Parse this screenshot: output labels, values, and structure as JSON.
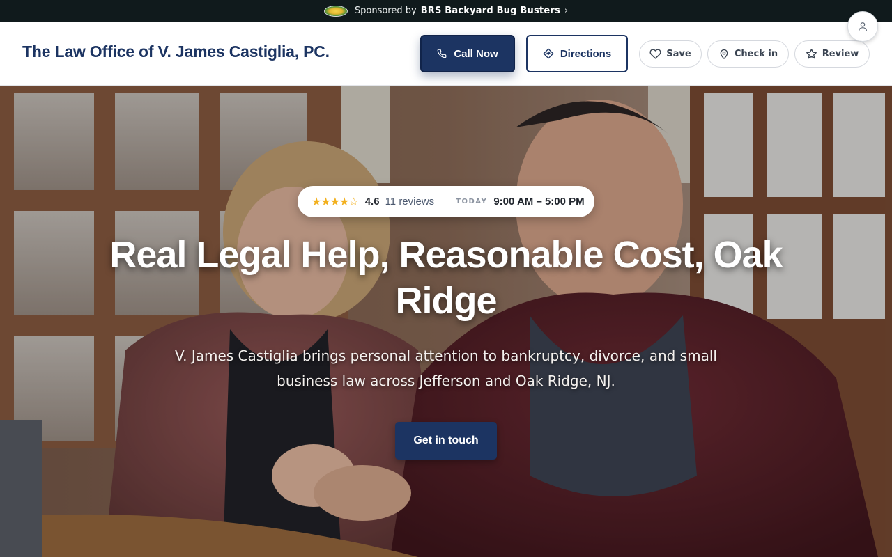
{
  "sponsor": {
    "prefix": "Sponsored by",
    "name": "BRS Backyard Bug Busters",
    "chevron": "›",
    "logo_icon": "sponsor-logo"
  },
  "header": {
    "brand": "The Law Office of V. James Castiglia, PC.",
    "call_label": "Call Now",
    "directions_label": "Directions",
    "save_label": "Save",
    "checkin_label": "Check in",
    "review_label": "Review"
  },
  "hero": {
    "rating": {
      "stars": "★★★★",
      "half_star": "☆",
      "value": "4.6",
      "reviews": "11 reviews",
      "today_label": "TODAY",
      "hours": "9:00 AM – 5:00 PM"
    },
    "headline": "Real Legal Help, Reasonable Cost, Oak Ridge",
    "subtext": "V. James Castiglia brings personal attention to bankruptcy, divorce, and small business law across Jefferson and Oak Ridge, NJ.",
    "cta_label": "Get in touch"
  },
  "colors": {
    "brand_navy": "#1c3462",
    "sponsor_bar": "#101a1c",
    "star": "#f2b01e"
  }
}
